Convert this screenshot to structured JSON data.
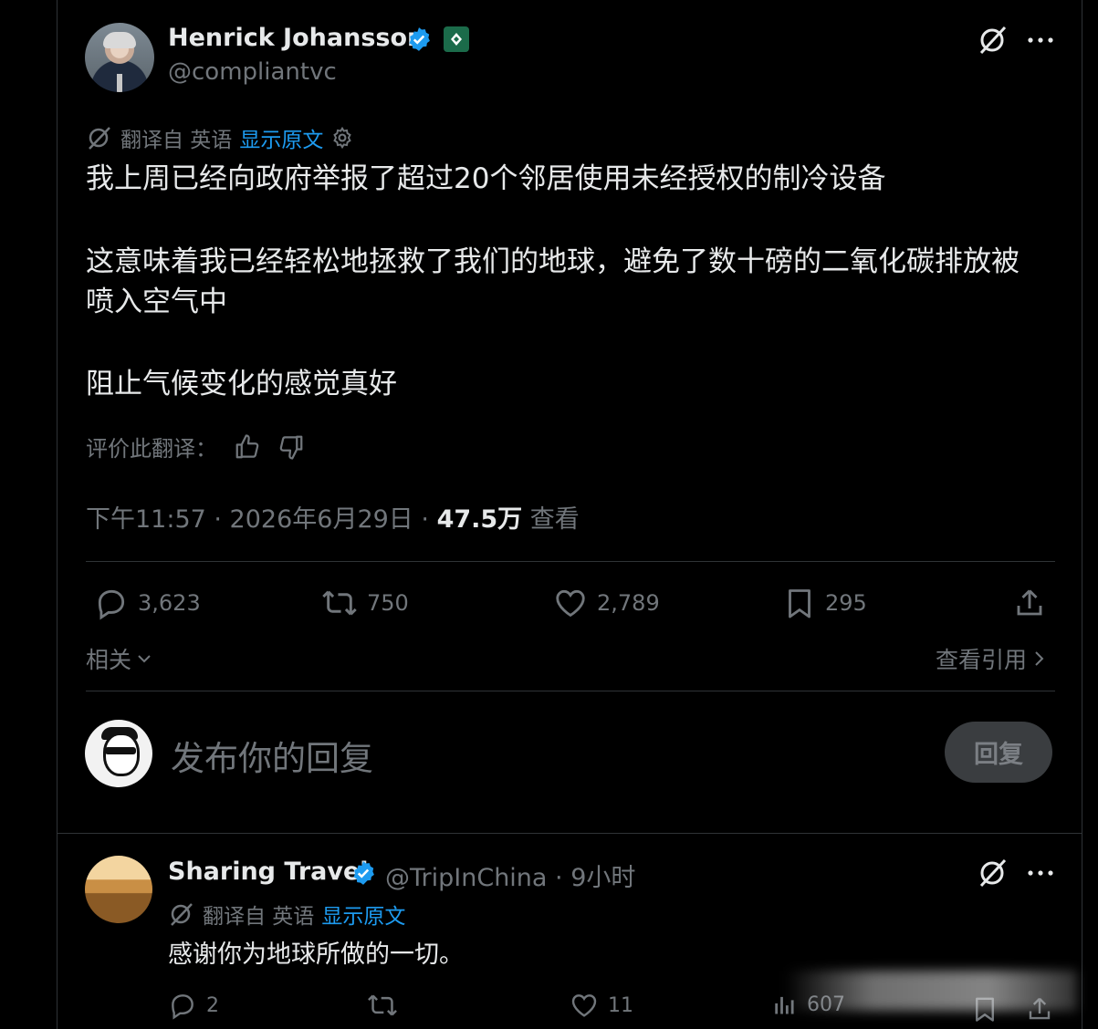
{
  "author": {
    "name": "Henrick Johansson",
    "handle": "@compliantvc"
  },
  "translation": {
    "prefix": "翻译自 英语",
    "show_original": "显示原文"
  },
  "tweet": {
    "line1": "我上周已经向政府举报了超过20个邻居使用未经授权的制冷设备",
    "line2": "这意味着我已经轻松地拯救了我们的地球，避免了数十磅的二氧化碳排放被",
    "line3": "喷入空气中",
    "line4": "阻止气候变化的感觉真好"
  },
  "rate": {
    "label": "评价此翻译："
  },
  "meta": {
    "time_date": "下午11:57 · 2026年6月29日 · ",
    "views": "47.5万",
    "views_label": " 查看"
  },
  "actions": {
    "replies": "3,623",
    "reposts": "750",
    "likes": "2,789",
    "bookmarks": "295"
  },
  "related": "相关",
  "view_quotes": "查看引用",
  "composer": {
    "placeholder": "发布你的回复",
    "button": "回复"
  },
  "reply": {
    "name": "Sharing Travel",
    "handle_time": "@TripInChina · 9小时",
    "translate_prefix": "翻译自 英语",
    "show_original": "显示原文",
    "text": "感谢你为地球所做的一切。",
    "replies": "2",
    "likes": "11",
    "views": "607"
  },
  "colors": {
    "accent": "#1d9bf0",
    "background": "#000000",
    "text": "#e7e9ea",
    "muted": "#71767b",
    "divider": "#2f3336"
  }
}
